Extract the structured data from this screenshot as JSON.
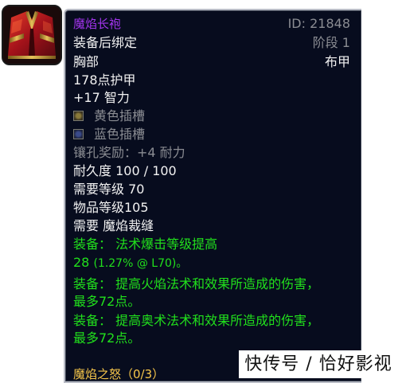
{
  "item": {
    "icon": "red-robe-icon",
    "name": "魔焰长袍",
    "id": "ID: 21848",
    "binding": "装备后绑定",
    "phase": "阶段 1",
    "slot": "胸部",
    "armor_type": "布甲",
    "armor": "178点护甲",
    "stat": "+17 智力",
    "sockets": [
      {
        "color": "yellow",
        "label": "黄色插槽"
      },
      {
        "color": "blue",
        "label": "蓝色插槽"
      }
    ],
    "socket_bonus": "镶孔奖励：+4 耐力",
    "durability": "耐久度 100 / 100",
    "required_level": "需要等级 70",
    "item_level": "物品等级105",
    "requires_profession": "需要 魔焰裁缝",
    "effects": [
      {
        "line1": "装备： 法术爆击等级提高",
        "line2_main": "28",
        "line2_detail": "(1.27% @ L70)。"
      },
      {
        "line1": "装备： 提高火焰法术和效果所造成的伤害，",
        "line2": "最多72点。"
      },
      {
        "line1": "装备： 提高奥术法术和效果所造成的伤害，",
        "line2": "最多72点。"
      }
    ],
    "set_name": "魔焰之怒（0/3）"
  },
  "watermark": "快传号 / 恰好影视",
  "colors": {
    "epic_purple": "#a335ee",
    "effect_green": "#21e01c",
    "set_gold": "#f6c64a",
    "tooltip_bg": "#070c1e"
  }
}
